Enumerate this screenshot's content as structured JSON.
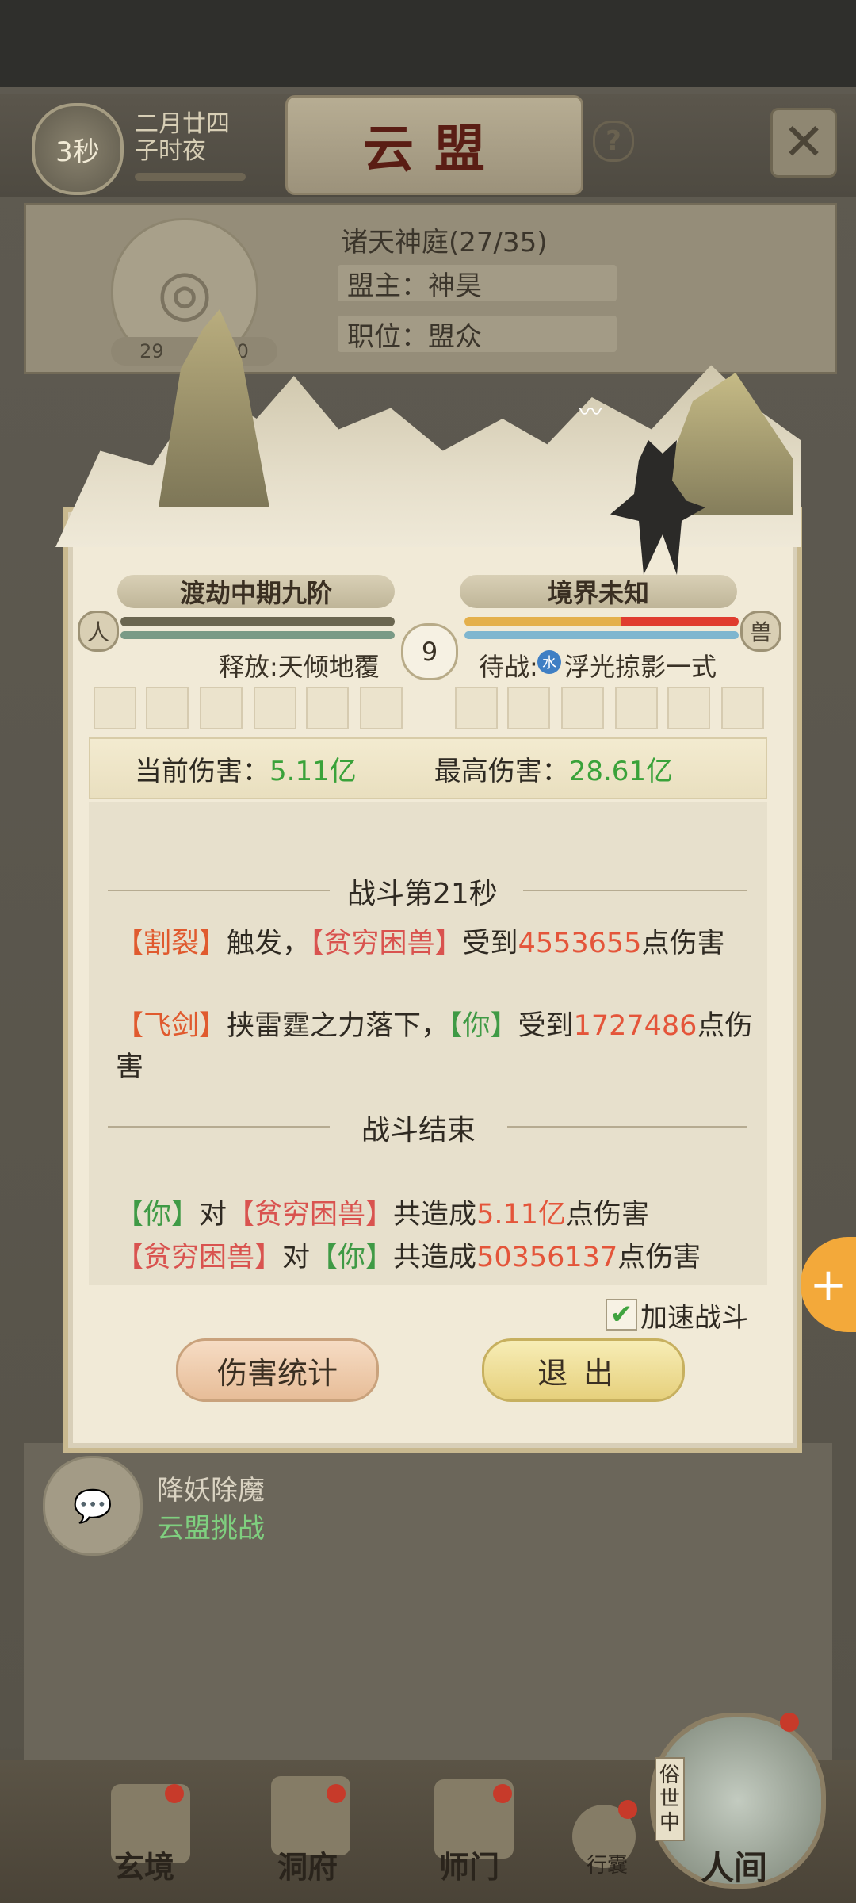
{
  "header": {
    "timer": "3秒",
    "date": "二月廿四\n子时夜",
    "title": "云盟",
    "help_icon": "question-icon",
    "close_icon": "swords-icon"
  },
  "alliance": {
    "name": "诸天神庭(27/35)",
    "leader": "盟主：神昊",
    "position": "职位：盟众",
    "exp": "29     /9000"
  },
  "battle": {
    "player_rank": "渡劫中期九阶",
    "enemy_rank": "境界未知",
    "round": "9",
    "player_skill": "释放:天倾地覆",
    "enemy_skill_prefix": "待战:",
    "enemy_element": "水",
    "enemy_skill": "浮光掠影一式",
    "hp_ratio_enemy": 0.57,
    "current_damage_label": "当前伤害：",
    "current_damage": "5.11亿",
    "max_damage_label": "最高伤害：",
    "max_damage": "28.61亿"
  },
  "log": {
    "section1": "战斗第21秒",
    "line1": {
      "a": "【割裂】",
      "b": "触发，",
      "c": "【贫穷困兽】",
      "d": "受到",
      "e": "4553655",
      "f": "点伤害"
    },
    "line2": {
      "a": "【飞剑】",
      "b": "挟雷霆之力落下，",
      "c": "【你】",
      "d": "受到",
      "e": "1727486",
      "f": "点伤害"
    },
    "section2": "战斗结束",
    "summary1": {
      "a": "【你】",
      "b": "对",
      "c": "【贫穷困兽】",
      "d": "共造成",
      "e": "5.11亿",
      "f": "点伤害"
    },
    "summary2": {
      "a": "【贫穷困兽】",
      "b": "对",
      "c": "【你】",
      "d": "共造成",
      "e": "50356137",
      "f": "点伤害"
    }
  },
  "controls": {
    "speedup_label": "加速战斗",
    "stats_button": "伤害统计",
    "exit_button": "退出"
  },
  "list": {
    "title": "降妖除魔",
    "subtitle": "云盟挑战"
  },
  "nav": {
    "items": [
      "玄境",
      "洞府",
      "师门",
      "行囊",
      "人间"
    ],
    "side_label": "俗世中"
  },
  "colors": {
    "green_value": "#3aa23a",
    "red_value": "#e4553a",
    "title_red": "#5a1d14"
  }
}
